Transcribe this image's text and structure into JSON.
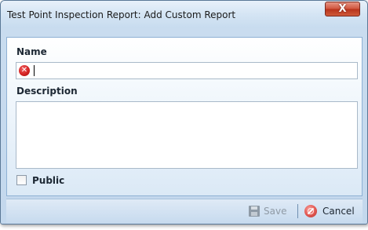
{
  "window": {
    "title": "Test Point Inspection Report:  Add Custom Report",
    "close_glyph": "X"
  },
  "form": {
    "name_label": "Name",
    "name_value": "",
    "description_label": "Description",
    "description_value": "",
    "public_label": "Public",
    "public_checked": false,
    "error_icon": "error-icon",
    "error_glyph": "✕"
  },
  "footer": {
    "save_label": "Save",
    "save_enabled": false,
    "cancel_label": "Cancel"
  },
  "colors": {
    "accent": "#c3d8ed",
    "error": "#d42323",
    "close": "#c8452c"
  }
}
